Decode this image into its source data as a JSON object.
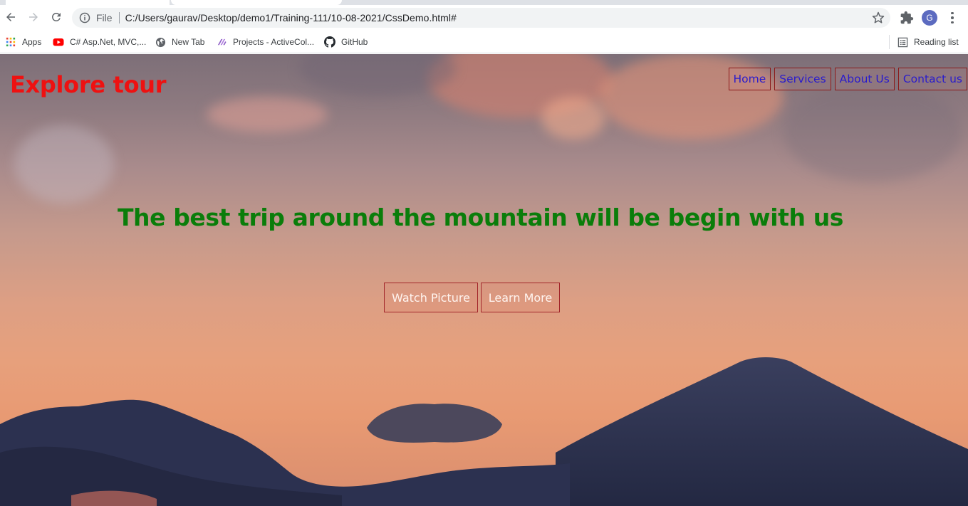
{
  "browser": {
    "url": "C:/Users/gaurav/Desktop/demo1/Training-111/10-08-2021/CssDemo.html#",
    "scheme_label": "File",
    "profile_initial": "G",
    "icons": {
      "back": "back-arrow-icon",
      "forward": "forward-arrow-icon",
      "reload": "reload-icon",
      "info": "info-icon",
      "bookmark": "star-icon",
      "extensions": "puzzle-icon",
      "menu": "kebab-menu-icon"
    }
  },
  "bookmarks": {
    "items": [
      {
        "label": "Apps",
        "icon": "apps-grid-icon"
      },
      {
        "label": "C# Asp.Net, MVC,...",
        "icon": "youtube-icon"
      },
      {
        "label": "New Tab",
        "icon": "globe-icon"
      },
      {
        "label": "Projects - ActiveCol...",
        "icon": "projects-icon"
      },
      {
        "label": "GitHub",
        "icon": "github-icon"
      }
    ],
    "reading_list": {
      "label": "Reading list",
      "icon": "reading-list-icon"
    }
  },
  "page": {
    "brand": "Explore tour",
    "nav": [
      {
        "label": "Home"
      },
      {
        "label": "Services"
      },
      {
        "label": "About Us"
      },
      {
        "label": "Contact us"
      }
    ],
    "headline": "The best trip around the mountain will be begin with us",
    "buttons": {
      "watch": "Watch Picture",
      "learn": "Learn More"
    },
    "colors": {
      "brand": "#ee1111",
      "nav_text": "#2a1ccc",
      "headline": "#0a7d0a",
      "button_border": "#a2262a"
    }
  }
}
